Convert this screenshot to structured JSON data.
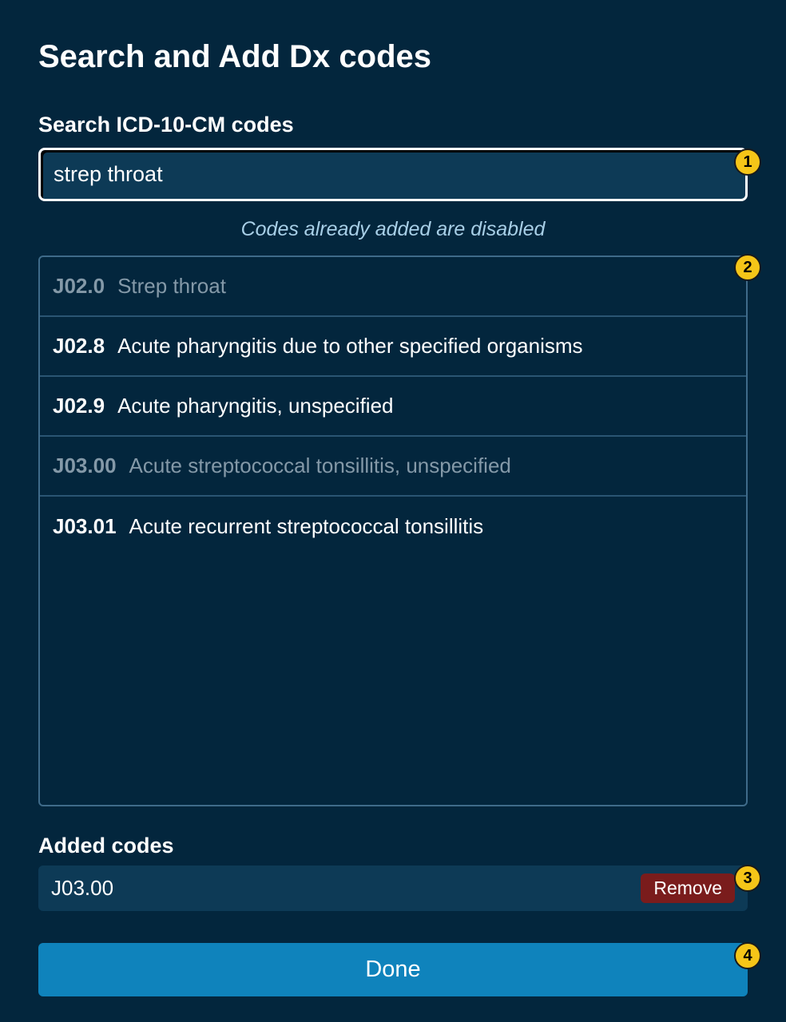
{
  "page": {
    "title": "Search and Add Dx codes"
  },
  "search": {
    "label": "Search ICD-10-CM codes",
    "value": "strep throat",
    "hint": "Codes already added are disabled"
  },
  "results": [
    {
      "code": "J02.0",
      "description": "Strep throat",
      "disabled": true
    },
    {
      "code": "J02.8",
      "description": "Acute pharyngitis due to other specified organisms",
      "disabled": false
    },
    {
      "code": "J02.9",
      "description": "Acute pharyngitis, unspecified",
      "disabled": false
    },
    {
      "code": "J03.00",
      "description": "Acute streptococcal tonsillitis, unspecified",
      "disabled": true
    },
    {
      "code": "J03.01",
      "description": "Acute recurrent streptococcal tonsillitis",
      "disabled": false
    }
  ],
  "added": {
    "label": "Added codes",
    "items": [
      {
        "code": "J03.00",
        "remove_label": "Remove"
      }
    ]
  },
  "done_label": "Done",
  "markers": [
    "1",
    "2",
    "3",
    "4"
  ],
  "colors": {
    "background": "#03263d",
    "input_background": "#0d3a56",
    "accent": "#0f83bc",
    "danger": "#7a1c1c",
    "marker": "#f5c518",
    "disabled_text": "#8499a8"
  }
}
